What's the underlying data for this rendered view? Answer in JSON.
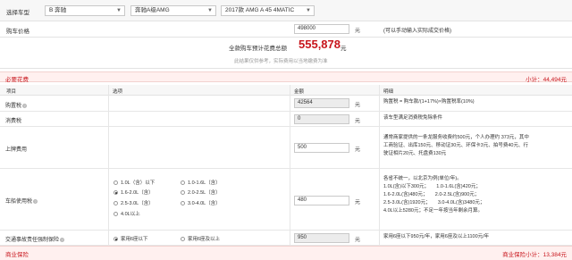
{
  "selectors": {
    "label": "选择车型",
    "brand": "B 奔驰",
    "series": "奔驰A级AMG",
    "model": "2017款 AMG A 45 4MATIC"
  },
  "price": {
    "label": "购车价格",
    "value": "498000",
    "unit": "元",
    "hint": "(可以手动输入实际成交价格)"
  },
  "summary": {
    "label": "全款购车预计花费总额",
    "total": "555,878",
    "unit": "元",
    "note": "此结果仅供参考，实际费用以当地缴费为准"
  },
  "section_required": {
    "title": "必要花费",
    "subtotal": "小计：44,494元"
  },
  "columns": {
    "item": "项目",
    "option": "选项",
    "amount": "金额",
    "detail": "明细"
  },
  "rows": {
    "purchase_tax": {
      "name": "购置税",
      "amount": "42564",
      "unit": "元",
      "detail": "购置税 = 购车款/(1+17%)×购置税率(10%)"
    },
    "consumption_tax": {
      "name": "消费税",
      "amount": "0",
      "unit": "元",
      "detail": "该车型满足消费税免除条件"
    },
    "registration": {
      "name": "上牌费用",
      "amount": "500",
      "unit": "元",
      "detail": [
        "通常商家提供的一条龙服务收费约500元，个人办理约 373元，其中",
        "工商验证、出库150元、移动证30元、环保卡3元、拍号费40元、行",
        "驶证相片20元、托盘费130元"
      ]
    },
    "vehicle_tax": {
      "name": "车船使用税",
      "amount": "480",
      "unit": "元",
      "options": [
        "1.0L（含）以下",
        "1.0-1.6L（含）",
        "1.6-2.0L（含）",
        "2.0-2.5L（含）",
        "2.5-3.0L（含）",
        "3.0-4.0L（含）",
        "4.0L以上"
      ],
      "selected": "1.6-2.0L（含）",
      "detail": [
        "各省不统一，以北京为例(单位/年)。",
        "1.0L(含)以下300元；　　1.0-1.6L(含)420元；",
        "1.6-2.0L(含)480元；　　2.0-2.5L(含)900元；",
        "2.5-3.0L(含)1920元；　　3.0-4.0L(含)3480元；",
        "4.0L以上5280元；不足一年按当年剩余月算。"
      ]
    },
    "compulsory_insurance": {
      "name": "交通事故责任强制保险",
      "amount": "950",
      "unit": "元",
      "options": [
        "家用6座以下",
        "家用6座及以上"
      ],
      "selected": "家用6座以下",
      "detail": "家用6座以下950元/年，家用6座及以上1100元/年"
    }
  },
  "section_insurance": {
    "title": "商业保险",
    "subtotal": "商业保险小计：13,384元"
  },
  "colors": {
    "accent": "#c8161d",
    "section_bg": "#fff0ef"
  }
}
